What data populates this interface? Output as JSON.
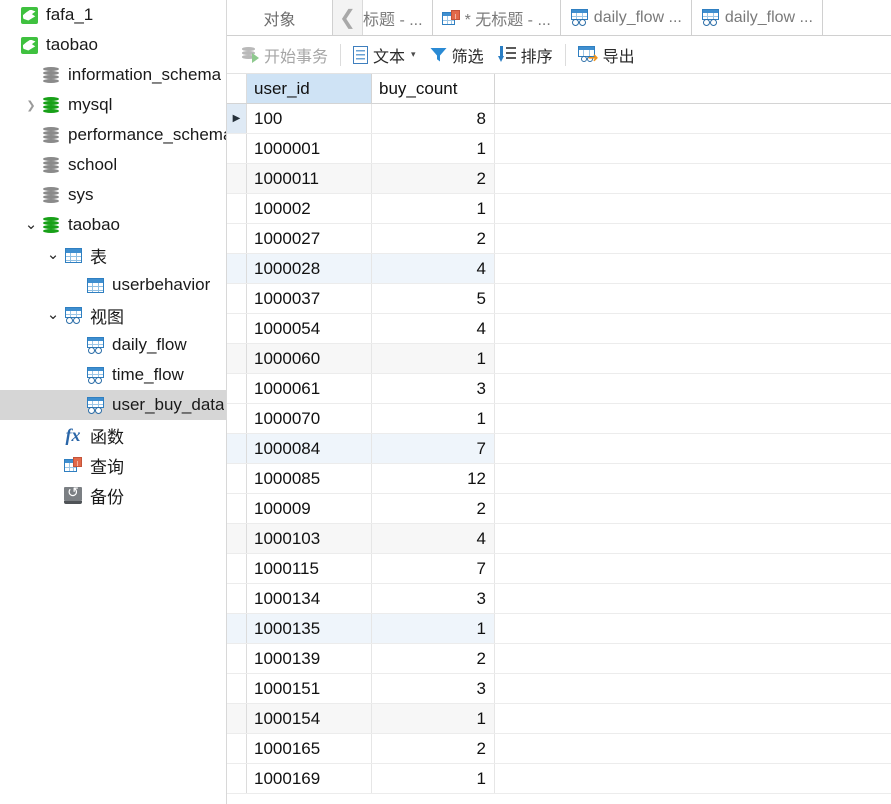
{
  "sidebar": {
    "items": [
      {
        "label": "fafa_1",
        "icon": "mysql-connection-icon",
        "indent": 0,
        "expander": "",
        "kind": "connection",
        "selected": false
      },
      {
        "label": "taobao",
        "icon": "mysql-connection-icon",
        "indent": 0,
        "expander": "",
        "kind": "connection",
        "selected": false
      },
      {
        "label": "information_schema",
        "icon": "database-icon",
        "indent": 1,
        "expander": "",
        "kind": "database",
        "state": "closed",
        "selected": false
      },
      {
        "label": "mysql",
        "icon": "database-icon",
        "indent": 1,
        "expander": "collapsed",
        "kind": "database",
        "state": "open",
        "selected": false
      },
      {
        "label": "performance_schema",
        "icon": "database-icon",
        "indent": 1,
        "expander": "",
        "kind": "database",
        "state": "closed",
        "selected": false
      },
      {
        "label": "school",
        "icon": "database-icon",
        "indent": 1,
        "expander": "",
        "kind": "database",
        "state": "closed",
        "selected": false
      },
      {
        "label": "sys",
        "icon": "database-icon",
        "indent": 1,
        "expander": "",
        "kind": "database",
        "state": "closed",
        "selected": false
      },
      {
        "label": "taobao",
        "icon": "database-icon",
        "indent": 1,
        "expander": "expanded",
        "kind": "database",
        "state": "open",
        "selected": false
      },
      {
        "label": "表",
        "icon": "table-folder-icon",
        "indent": 2,
        "expander": "expanded",
        "kind": "table-group",
        "selected": false
      },
      {
        "label": "userbehavior",
        "icon": "table-icon",
        "indent": 3,
        "expander": "",
        "kind": "table",
        "selected": false
      },
      {
        "label": "视图",
        "icon": "view-folder-icon",
        "indent": 2,
        "expander": "expanded",
        "kind": "view-group",
        "selected": false
      },
      {
        "label": "daily_flow",
        "icon": "view-icon",
        "indent": 3,
        "expander": "",
        "kind": "view",
        "selected": false
      },
      {
        "label": "time_flow",
        "icon": "view-icon",
        "indent": 3,
        "expander": "",
        "kind": "view",
        "selected": false
      },
      {
        "label": "user_buy_data",
        "icon": "view-icon",
        "indent": 3,
        "expander": "",
        "kind": "view",
        "selected": true
      },
      {
        "label": "函数",
        "icon": "function-icon",
        "indent": 2,
        "expander": "",
        "kind": "function-group",
        "selected": false
      },
      {
        "label": "查询",
        "icon": "query-icon",
        "indent": 2,
        "expander": "",
        "kind": "query-group",
        "selected": false
      },
      {
        "label": "备份",
        "icon": "backup-icon",
        "indent": 2,
        "expander": "",
        "kind": "backup-group",
        "selected": false
      }
    ]
  },
  "tabstrip": {
    "object_tab_label": "对象",
    "back_button_glyph": "❮",
    "tabs": [
      {
        "label": "标题 - ...",
        "icon": "none",
        "modified": false
      },
      {
        "label": "* 无标题 - ...",
        "icon": "query-icon",
        "modified": true
      },
      {
        "label": "daily_flow ...",
        "icon": "view-icon",
        "modified": false
      },
      {
        "label": "daily_flow ...",
        "icon": "view-icon",
        "modified": false
      }
    ]
  },
  "toolbar": {
    "begin_transaction_label": "开始事务",
    "text_label": "文本",
    "text_caret": "▾",
    "filter_label": "筛选",
    "sort_label": "排序",
    "export_label": "导出"
  },
  "grid_data": {
    "type": "table",
    "columns": [
      "user_id",
      "buy_count"
    ],
    "highlighted_column": "user_id",
    "current_row_index": 0,
    "rows": [
      [
        "100",
        "8"
      ],
      [
        "1000001",
        "1"
      ],
      [
        "1000011",
        "2"
      ],
      [
        "100002",
        "1"
      ],
      [
        "1000027",
        "2"
      ],
      [
        "1000028",
        "4"
      ],
      [
        "1000037",
        "5"
      ],
      [
        "1000054",
        "4"
      ],
      [
        "1000060",
        "1"
      ],
      [
        "1000061",
        "3"
      ],
      [
        "1000070",
        "1"
      ],
      [
        "1000084",
        "7"
      ],
      [
        "1000085",
        "12"
      ],
      [
        "100009",
        "2"
      ],
      [
        "1000103",
        "4"
      ],
      [
        "1000115",
        "7"
      ],
      [
        "1000134",
        "3"
      ],
      [
        "1000135",
        "1"
      ],
      [
        "1000139",
        "2"
      ],
      [
        "1000151",
        "3"
      ],
      [
        "1000154",
        "1"
      ],
      [
        "1000165",
        "2"
      ],
      [
        "1000169",
        "1"
      ]
    ],
    "row_tints": [
      "current",
      "plain",
      "alt",
      "plain",
      "plain",
      "blue",
      "plain",
      "plain",
      "alt",
      "plain",
      "plain",
      "blue",
      "plain",
      "plain",
      "alt",
      "plain",
      "plain",
      "blue",
      "plain",
      "plain",
      "alt",
      "plain",
      "plain"
    ]
  },
  "colors": {
    "accent_blue": "#2f7fc1",
    "header_highlight": "#cfe3f5",
    "selection_gray": "#d6d6d6",
    "db_green": "#18a018",
    "row_blue_tint": "#eff5fb",
    "row_alt_tint": "#f7f7f7"
  }
}
